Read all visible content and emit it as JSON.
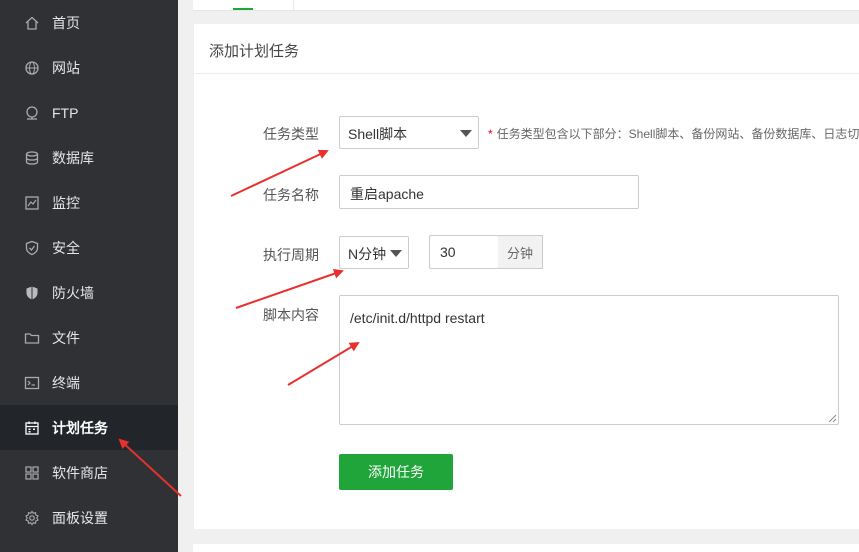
{
  "sidebar": {
    "items": [
      {
        "label": "首页",
        "icon": "home-icon"
      },
      {
        "label": "网站",
        "icon": "globe-icon"
      },
      {
        "label": "FTP",
        "icon": "ftp-icon"
      },
      {
        "label": "数据库",
        "icon": "database-icon"
      },
      {
        "label": "监控",
        "icon": "monitor-icon"
      },
      {
        "label": "安全",
        "icon": "shield-icon"
      },
      {
        "label": "防火墙",
        "icon": "firewall-icon"
      },
      {
        "label": "文件",
        "icon": "folder-icon"
      },
      {
        "label": "终端",
        "icon": "terminal-icon"
      },
      {
        "label": "计划任务",
        "icon": "calendar-icon",
        "active": true
      },
      {
        "label": "软件商店",
        "icon": "apps-icon"
      },
      {
        "label": "面板设置",
        "icon": "settings-icon"
      }
    ]
  },
  "panel": {
    "title": "添加计划任务"
  },
  "form": {
    "task_type": {
      "label": "任务类型",
      "value": "Shell脚本",
      "hint_star": "*",
      "hint": "任务类型包含以下部分：Shell脚本、备份网站、备份数据库、日志切"
    },
    "task_name": {
      "label": "任务名称",
      "value": "重启apache"
    },
    "period": {
      "label": "执行周期",
      "unit_select": "N分钟",
      "amount": "30",
      "unit_suffix": "分钟"
    },
    "script": {
      "label": "脚本内容",
      "value": "/etc/init.d/httpd restart"
    },
    "submit_label": "添加任务"
  },
  "colors": {
    "sidebar_bg": "#2f3135",
    "sidebar_active_bg": "#22252a",
    "accent_green": "#20a53a",
    "annotation_red": "#e8312f"
  }
}
